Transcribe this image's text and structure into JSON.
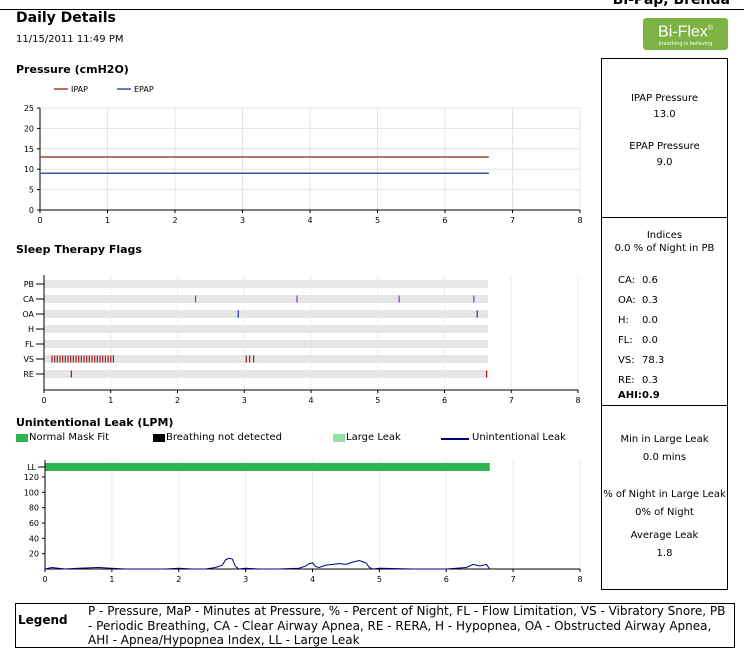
{
  "header": {
    "patient_name": "Bi-Pap, Brenda",
    "title": "Daily Details",
    "datetime": "11/15/2011 11:49 PM",
    "logo_text": "Bi-Flex",
    "logo_mark": "®",
    "logo_tagline": "breathing is believing",
    "logo_color": "#7cb342"
  },
  "pressure_chart": {
    "section_title": "Pressure (cmH2O)",
    "chart_data": {
      "type": "line",
      "x_ticks": [
        "0",
        "1",
        "2",
        "3",
        "4",
        "5",
        "6",
        "7",
        "8"
      ],
      "y_ticks": [
        "0",
        "5",
        "10",
        "15",
        "20",
        "25"
      ],
      "xlim": [
        0,
        8
      ],
      "ylim": [
        0,
        25
      ],
      "series": [
        {
          "name": "IPAP",
          "color": "#a0403c",
          "x": [
            0,
            6.65
          ],
          "y": [
            13,
            13
          ]
        },
        {
          "name": "EPAP",
          "color": "#4050a0",
          "x": [
            0,
            6.65
          ],
          "y": [
            9,
            9
          ]
        }
      ]
    }
  },
  "pressure_panel": {
    "ipap_label": "IPAP Pressure",
    "ipap_value": "13.0",
    "epap_label": "EPAP Pressure",
    "epap_value": "9.0"
  },
  "flags_chart": {
    "section_title": "Sleep Therapy Flags",
    "chart_data": {
      "type": "scatter",
      "categories": [
        "PB",
        "CA",
        "OA",
        "H",
        "FL",
        "VS",
        "RE"
      ],
      "x_ticks": [
        "0",
        "1",
        "2",
        "3",
        "4",
        "5",
        "6",
        "7",
        "8"
      ],
      "xlim": [
        0,
        8
      ],
      "band_end": 6.65,
      "events": {
        "PB": [],
        "CA": [
          2.27,
          3.79,
          5.32,
          6.44
        ],
        "OA": [
          2.91,
          6.49
        ],
        "H": [],
        "FL": [],
        "VS": [
          0.12,
          0.16,
          0.2,
          0.24,
          0.28,
          0.32,
          0.36,
          0.4,
          0.44,
          0.48,
          0.52,
          0.56,
          0.6,
          0.64,
          0.68,
          0.72,
          0.76,
          0.8,
          0.84,
          0.88,
          0.92,
          0.96,
          1.0,
          1.04,
          3.03,
          3.08,
          3.14
        ],
        "RE": [
          0.41,
          6.63
        ]
      },
      "event_colors": {
        "CA": "#8040b0",
        "OA": "#2030c0",
        "VS": "#a01818",
        "RE": "#a01818"
      }
    }
  },
  "indices_panel": {
    "title": "Indices",
    "pb_line": "0.0 % of Night in PB",
    "rows": [
      {
        "label": "CA:",
        "value": "0.6"
      },
      {
        "label": "OA:",
        "value": "0.3"
      },
      {
        "label": "H:",
        "value": "0.0"
      },
      {
        "label": "FL:",
        "value": "0.0"
      },
      {
        "label": "VS:",
        "value": "78.3"
      },
      {
        "label": "RE:",
        "value": "0.3"
      }
    ],
    "ahi_label": "AHI:",
    "ahi_value": "0.9"
  },
  "leak_chart": {
    "section_title": "Unintentional Leak (LPM)",
    "legend": {
      "normal": "Normal Mask Fit",
      "not_detected": "Breathing not detected",
      "large": "Large Leak",
      "unintentional": "Unintentional Leak"
    },
    "colors": {
      "normal": "#2eb552",
      "not_detected": "#000000",
      "large": "#90e0a8",
      "unintentional": "#000080"
    },
    "chart_data": {
      "type": "line",
      "x_ticks": [
        "0",
        "1",
        "2",
        "3",
        "4",
        "5",
        "6",
        "7",
        "8"
      ],
      "y_ticks": [
        "20",
        "40",
        "60",
        "80",
        "100",
        "120"
      ],
      "ll_label": "LL",
      "xlim": [
        0,
        8
      ],
      "ylim": [
        0,
        130
      ],
      "normal_band": [
        0,
        6.65
      ],
      "series": [
        {
          "name": "Unintentional Leak",
          "x": [
            0,
            0.1,
            0.2,
            0.3,
            0.5,
            0.8,
            1.0,
            1.2,
            1.4,
            1.6,
            1.8,
            2.0,
            2.2,
            2.4,
            2.55,
            2.65,
            2.7,
            2.75,
            2.8,
            2.85,
            2.9,
            3.0,
            3.2,
            3.5,
            3.8,
            3.9,
            3.95,
            4.0,
            4.05,
            4.1,
            4.2,
            4.3,
            4.4,
            4.5,
            4.6,
            4.7,
            4.8,
            4.85,
            4.9,
            5.0,
            5.5,
            6.0,
            6.3,
            6.4,
            6.45,
            6.5,
            6.6,
            6.65
          ],
          "y": [
            0,
            2,
            1,
            0,
            1,
            2,
            1,
            0,
            0,
            0,
            0,
            1,
            0,
            0,
            2,
            5,
            12,
            14,
            13,
            3,
            0,
            1,
            0,
            0,
            1,
            4,
            7,
            8,
            3,
            2,
            5,
            6,
            7,
            6,
            9,
            11,
            8,
            2,
            0,
            1,
            0,
            0,
            2,
            6,
            5,
            4,
            6,
            0
          ]
        }
      ]
    }
  },
  "leak_panel": {
    "min_large_label": "Min in Large Leak",
    "min_large_value": "0.0 mins",
    "pct_large_label": "% of Night in Large Leak",
    "pct_large_value": "0% of Night",
    "avg_label": "Average Leak",
    "avg_value": "1.8"
  },
  "legend": {
    "label": "Legend",
    "text": "P - Pressure, MaP - Minutes at Pressure, % - Percent of Night, FL - Flow Limitation, VS - Vibratory Snore, PB - Periodic Breathing, CA - Clear Airway Apnea, RE - RERA, H - Hypopnea, OA - Obstructed Airway Apnea, AHI - Apnea/Hypopnea Index, LL - Large Leak"
  }
}
